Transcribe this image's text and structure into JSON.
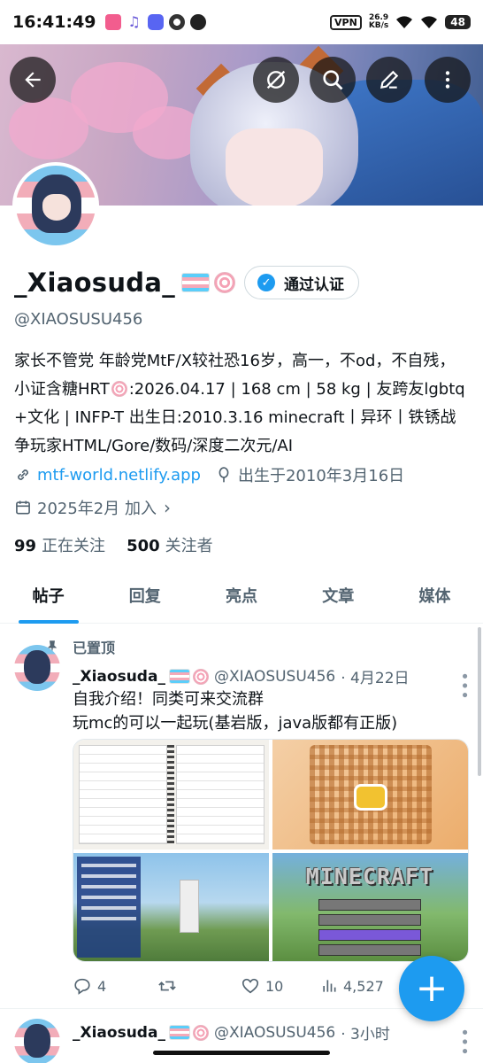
{
  "status_bar": {
    "time": "16:41:49",
    "vpn": "VPN",
    "net_speed": "26.9",
    "net_unit": "KB/s",
    "battery": "48",
    "app_icons": [
      "bilibili-icon",
      "music-icon",
      "discord-icon",
      "chrome-icon",
      "app-icon"
    ]
  },
  "header": {
    "back_icon": "arrow-left-icon",
    "mute_icon": "no-eye-icon",
    "search_icon": "search-icon",
    "edit_icon": "pencil-icon",
    "more_icon": "vertical-dots-icon"
  },
  "profile": {
    "name": "_Xiaosuda_",
    "verify_button": "通过认证",
    "handle": "@XIAOSUSU456",
    "bio_part1": "家长不管党 年龄党MtF/X较社恐16岁，高一，不od，不自残，小证含糖HRT",
    "bio_part2": ":2026.04.17 | 168 cm | 58 kg | 友跨友lgbtq+文化 | INFP-T 出生日:2010.3.16 minecraft丨异环丨铁锈战争玩家HTML/Gore/数码/深度二次元/AI",
    "website": "mtf-world.netlify.app",
    "birthday": "出生于2010年3月16日",
    "joined": "2025年2月 加入",
    "following_count": "99",
    "following_label": "正在关注",
    "followers_count": "500",
    "followers_label": "关注者"
  },
  "tabs": [
    "帖子",
    "回复",
    "亮点",
    "文章",
    "媒体"
  ],
  "active_tab": 0,
  "pinned_label": "已置顶",
  "post": {
    "name": "_Xiaosuda_",
    "handle": "@XIAOSUSU456",
    "date": "· 4月22日",
    "line1": "自我介绍！同类可来交流群",
    "line2": "玩mc的可以一起玩(基岩版，java版都有正版)",
    "media_label": "MINECRAFT",
    "replies": "4",
    "retweets": "",
    "likes": "10",
    "views": "4,527"
  },
  "next_post": {
    "name": "_Xiaosuda_",
    "handle": "@XIAOSUSU456",
    "time": "· 3小时"
  },
  "fab_label": "+",
  "colors": {
    "accent": "#1d9bf0",
    "text": "#0f1419",
    "muted": "#536471"
  }
}
